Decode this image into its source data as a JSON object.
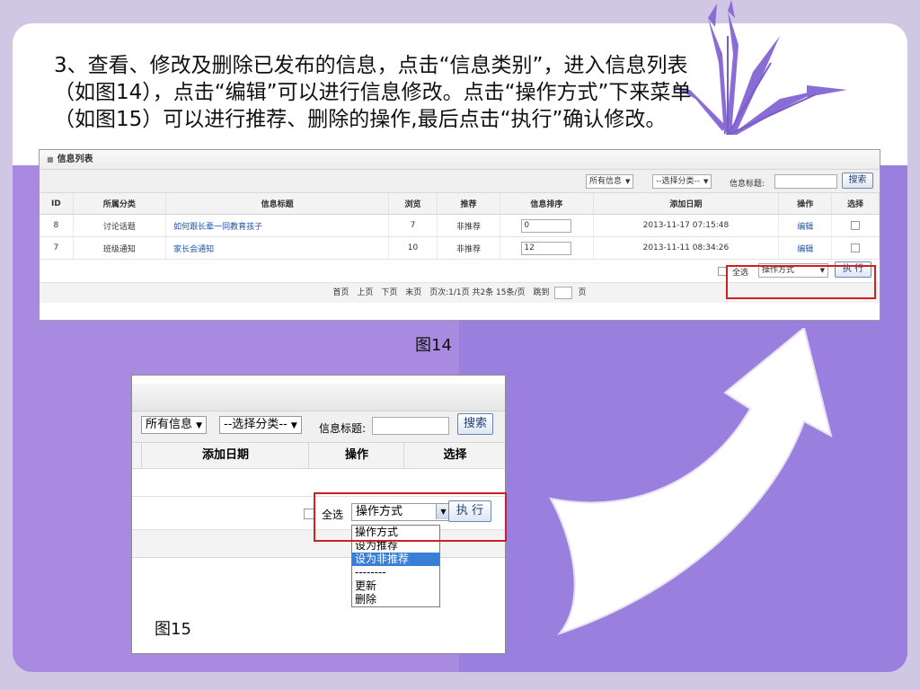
{
  "slide": {
    "heading_lines": [
      "3、查看、修改及删除已发布的信息，点击“信息类别”，进入信息列表",
      "（如图14），点击“编辑”可以进行信息修改。点击“操作方式”下来菜单",
      "（如图15）可以进行推荐、删除的操作,最后点击“执行”确认修改。"
    ],
    "colors": {
      "accent": "#a88be0",
      "accent_dark": "#9a7fde",
      "highlight_border": "#d02020"
    }
  },
  "fig14": {
    "caption": "图14",
    "panel_title": "信息列表",
    "search": {
      "type_select": "所有信息",
      "category_select": "--选择分类--",
      "title_label": "信息标题:",
      "title_value": "",
      "search_button": "搜索"
    },
    "columns": [
      "ID",
      "所属分类",
      "信息标题",
      "浏览",
      "推荐",
      "信息排序",
      "添加日期",
      "操作",
      "选择"
    ],
    "rows": [
      {
        "id": "8",
        "category": "讨论话题",
        "title": "如何跟长辈一同教育孩子",
        "views": "7",
        "recommend": "非推荐",
        "order": "0",
        "date": "2013-11-17 07:15:48",
        "action": "编辑"
      },
      {
        "id": "7",
        "category": "班级通知",
        "title": "家长会通知",
        "views": "10",
        "recommend": "非推荐",
        "order": "12",
        "date": "2013-11-11 08:34:26",
        "action": "编辑"
      }
    ],
    "footer": {
      "select_all": "全选",
      "operation_select": "操作方式",
      "execute_button": "执 行"
    },
    "pager": {
      "first": "首页",
      "prev": "上页",
      "next": "下页",
      "last": "末页",
      "page_info": "页次:1/1页 共2条 15条/页",
      "jump": "跳到",
      "page_unit": "页"
    }
  },
  "fig15": {
    "caption": "图15",
    "search": {
      "type_select": "所有信息",
      "category_select": "--选择分类--",
      "title_label": "信息标题:",
      "search_button": "搜索"
    },
    "columns": [
      "添加日期",
      "操作",
      "选择"
    ],
    "footer": {
      "select_all": "全选",
      "operation_select": "操作方式",
      "execute_button": "执 行"
    },
    "dropdown_options": [
      "操作方式",
      "设为推荐",
      "设为非推荐",
      "--------",
      "更新",
      "删除"
    ],
    "highlighted_option": "设为非推荐"
  }
}
